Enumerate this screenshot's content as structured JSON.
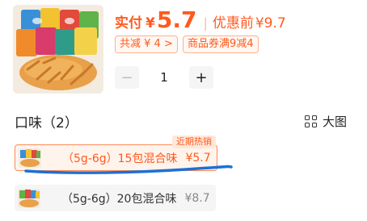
{
  "price": {
    "label": "实付",
    "currency_symbol": "¥",
    "value": "5.7",
    "separator": "|",
    "before_label": "优惠前",
    "before_value": "¥9.7",
    "accent_color": "#ff5a1f"
  },
  "tags": {
    "total_discount": "共减 ¥ 4 >",
    "coupon": "商品券满9减4"
  },
  "stepper": {
    "minus": "−",
    "quantity": "1",
    "plus": "+"
  },
  "flavors": {
    "title": "口味（2）",
    "view_toggle": "大图",
    "options": [
      {
        "label": "（5g-6g）15包混合味",
        "price": "¥5.7",
        "badge": "近期热销",
        "selected": true
      },
      {
        "label": "（5g-6g）20包混合味",
        "price": "¥8.7",
        "selected": false
      }
    ]
  }
}
